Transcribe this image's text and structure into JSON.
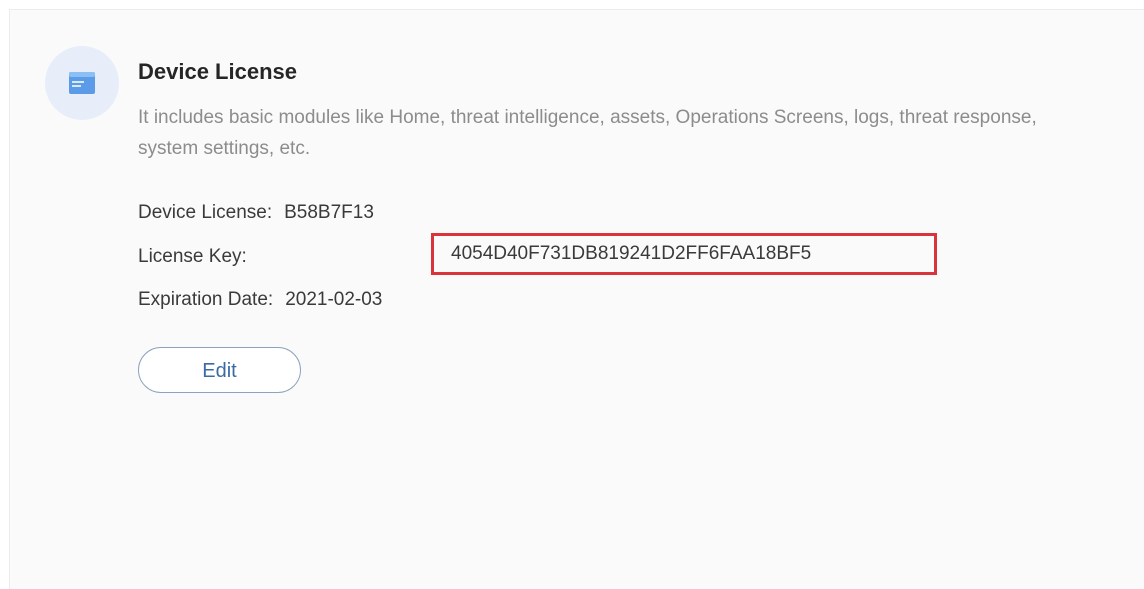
{
  "license": {
    "icon": "license-window-icon",
    "title": "Device License",
    "description": "It includes basic modules like Home, threat intelligence, assets, Operations Screens, logs, threat response, system settings, etc.",
    "device_license_label": "Device License:",
    "device_license_value": "B58B7F13",
    "license_key_label": "License Key:",
    "license_key_value": "4054D40F731DB819241D2FF6FAA18BF5",
    "expiration_label": "Expiration Date:",
    "expiration_value": "2021-02-03",
    "edit_label": "Edit"
  },
  "colors": {
    "icon_bg": "#e7eef9",
    "icon_fg": "#5b9be8",
    "highlight_border": "#d9343b",
    "button_text": "#3b6aa5"
  }
}
